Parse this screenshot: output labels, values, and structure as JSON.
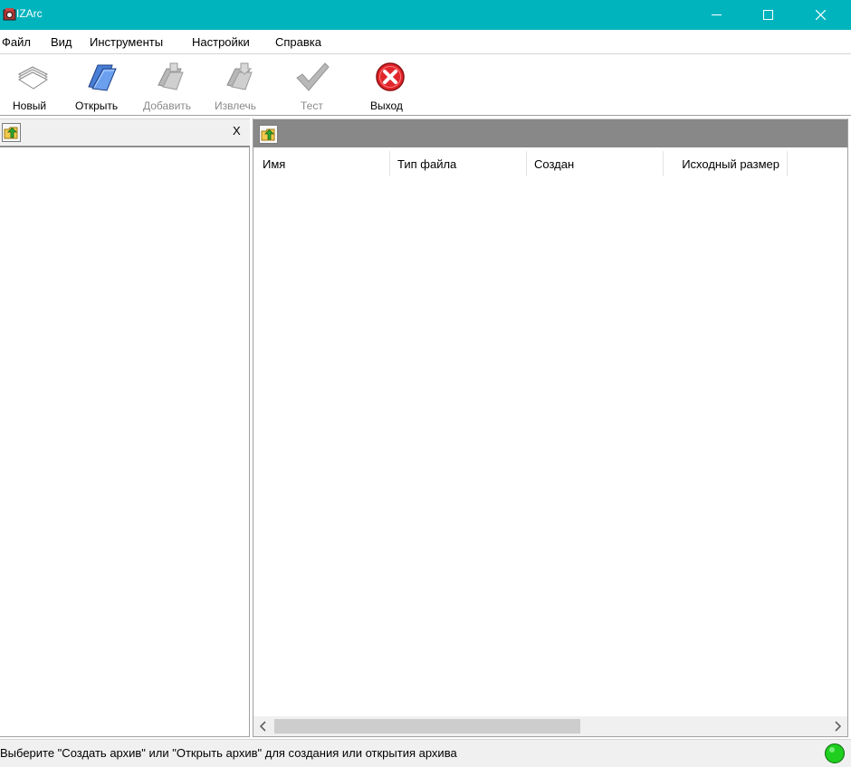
{
  "window": {
    "title": "IZArc"
  },
  "menu": [
    "Файл",
    "Вид",
    "Инструменты",
    "Настройки",
    "Справка"
  ],
  "toolbar": {
    "new_label": "Новый",
    "open_label": "Открыть",
    "add_label": "Добавить",
    "extract_label": "Извлечь",
    "test_label": "Тест",
    "exit_label": "Выход"
  },
  "left_panel": {
    "close_label": "X"
  },
  "columns": [
    "Имя",
    "Тип файла",
    "Создан",
    "Исходный размер"
  ],
  "status": {
    "text": "Выберите \"Создать архив\" или \"Открыть архив\" для создания или открытия архива",
    "indicator_color": "#1fcf1f"
  },
  "icons": {
    "app": "izarc-app-icon",
    "new": "new-archive-icon",
    "open": "open-folder-icon",
    "add": "add-icon",
    "extract": "extract-icon",
    "test": "checkmark-icon",
    "exit": "exit-icon",
    "up": "folder-up-icon"
  }
}
